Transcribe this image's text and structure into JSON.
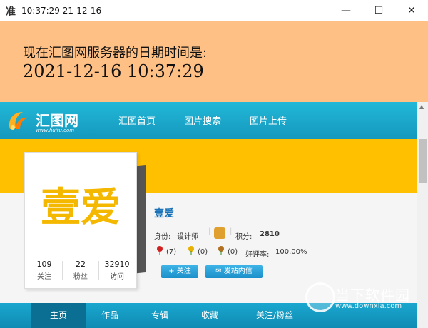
{
  "window": {
    "icon_glyph": "准",
    "title": "10:37:29 21-12-16",
    "minimize_glyph": "—",
    "maximize_glyph": "☐",
    "close_glyph": "✕"
  },
  "server_time": {
    "label": "现在汇图网服务器的日期时间是:",
    "datetime": "2021-12-16 10:37:29"
  },
  "site": {
    "logo_text": "汇图网",
    "logo_url": "www.huitu.com",
    "nav": [
      "汇图首页",
      "图片搜索",
      "图片上传"
    ]
  },
  "profile": {
    "avatar_text": "壹爱",
    "name": "壹爱",
    "identity_label": "身份:",
    "identity": "设计师",
    "points_label": "积分:",
    "points": "2810",
    "flowers": [
      "(7)",
      "(0)",
      "(0)"
    ],
    "rating_label": "好评率:",
    "rating": "100.00%",
    "stats": [
      {
        "num": "109",
        "label": "关注"
      },
      {
        "num": "22",
        "label": "粉丝"
      },
      {
        "num": "32910",
        "label": "访问"
      }
    ],
    "follow_button": "+ 关注",
    "message_button": "发站内信"
  },
  "bottom_nav": [
    "主页",
    "作品",
    "专辑",
    "收藏",
    "关注/粉丝"
  ],
  "watermark": {
    "text": "当下软件园",
    "url": "www.downxia.com"
  },
  "colors": {
    "orange_bg": "#ffc085",
    "nav_blue": "#1598bd",
    "yellow_banner": "#ffc000",
    "avatar_yellow": "#f5b800"
  }
}
